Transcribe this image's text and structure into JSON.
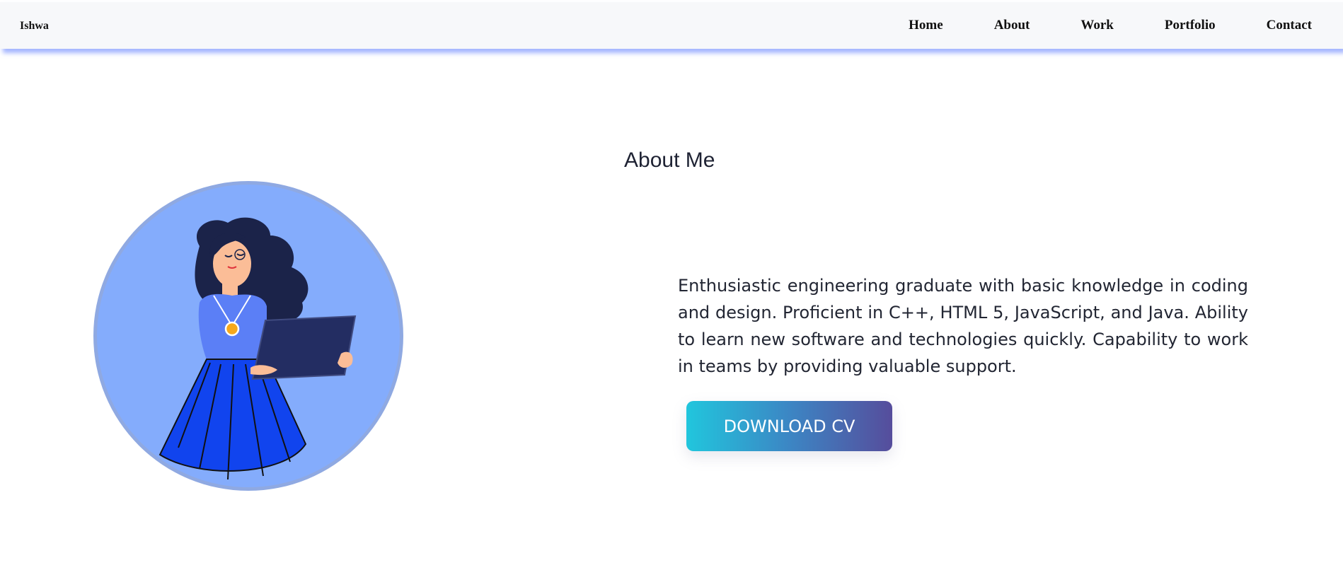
{
  "navbar": {
    "brand": "Ishwa",
    "links": [
      {
        "label": "Home"
      },
      {
        "label": "About"
      },
      {
        "label": "Work"
      },
      {
        "label": "Portfolio"
      },
      {
        "label": "Contact"
      }
    ]
  },
  "about": {
    "title": "About Me",
    "description": "Enthusiastic engineering graduate with basic knowledge in coding and design. Proficient in C++, HTML 5, JavaScript, and Java. Ability to learn new software and technologies quickly. Capability to work in teams by providing valuable support.",
    "cta_label": "DOWNLOAD CV",
    "illustration": "woman-holding-laptop-illustration"
  },
  "colors": {
    "accent_shadow": "#5a78ff",
    "avatar_bg": "#84acfc",
    "avatar_ring": "#8fa9e2",
    "button_gradient_start": "#21c6dd",
    "button_gradient_end": "#564d9c"
  }
}
